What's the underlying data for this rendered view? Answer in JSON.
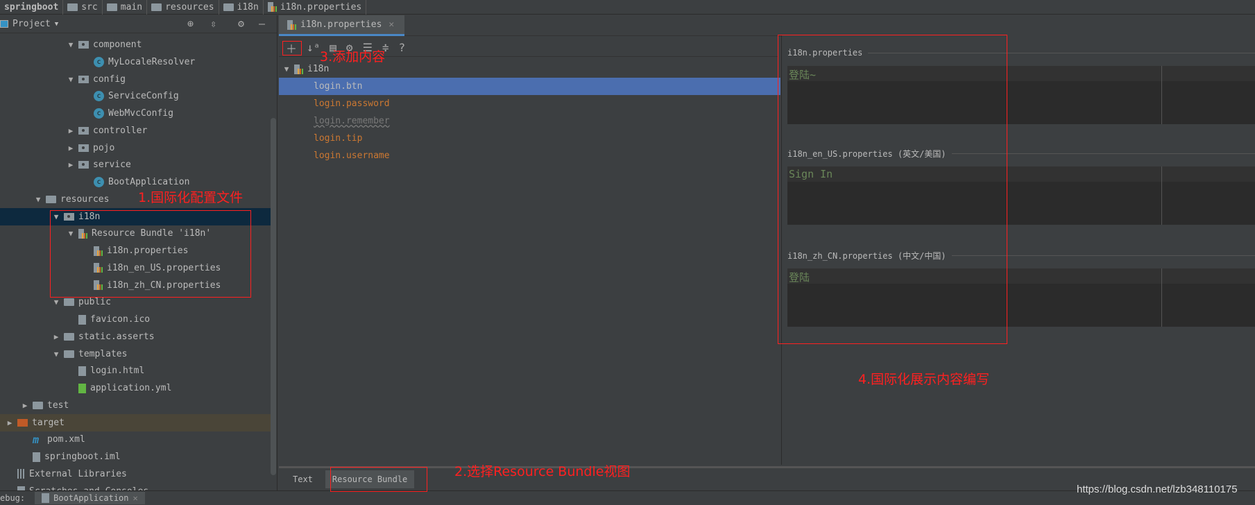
{
  "breadcrumb": [
    "springboot",
    "src",
    "main",
    "resources",
    "i18n",
    "i18n.properties"
  ],
  "project": {
    "title": "Project",
    "tree": [
      {
        "label": "component",
        "depth": 4,
        "icon": "package",
        "expanded": true
      },
      {
        "label": "MyLocaleResolver",
        "depth": 5,
        "icon": "class"
      },
      {
        "label": "config",
        "depth": 4,
        "icon": "package",
        "expanded": true
      },
      {
        "label": "ServiceConfig",
        "depth": 5,
        "icon": "class"
      },
      {
        "label": "WebMvcConfig",
        "depth": 5,
        "icon": "class"
      },
      {
        "label": "controller",
        "depth": 4,
        "icon": "package",
        "expanded": false
      },
      {
        "label": "pojo",
        "depth": 4,
        "icon": "package",
        "expanded": false
      },
      {
        "label": "service",
        "depth": 4,
        "icon": "package",
        "expanded": false
      },
      {
        "label": "BootApplication",
        "depth": 5,
        "icon": "spring-class"
      },
      {
        "label": "resources",
        "depth": 2,
        "icon": "resources-folder",
        "expanded": true
      },
      {
        "label": "i18n",
        "depth": 3,
        "icon": "package",
        "expanded": true,
        "selected": true
      },
      {
        "label": "Resource Bundle 'i18n'",
        "depth": 4,
        "icon": "resource-bundle",
        "expanded": true
      },
      {
        "label": "i18n.properties",
        "depth": 5,
        "icon": "properties"
      },
      {
        "label": "i18n_en_US.properties",
        "depth": 5,
        "icon": "properties"
      },
      {
        "label": "i18n_zh_CN.properties",
        "depth": 5,
        "icon": "properties"
      },
      {
        "label": "public",
        "depth": 3,
        "icon": "folder",
        "expanded": true
      },
      {
        "label": "favicon.ico",
        "depth": 4,
        "icon": "file"
      },
      {
        "label": "static.asserts",
        "depth": 3,
        "icon": "folder",
        "expanded": false
      },
      {
        "label": "templates",
        "depth": 3,
        "icon": "folder",
        "expanded": true
      },
      {
        "label": "login.html",
        "depth": 4,
        "icon": "html"
      },
      {
        "label": "application.yml",
        "depth": 4,
        "icon": "yml"
      },
      {
        "label": "test",
        "depth": 1,
        "icon": "folder",
        "expanded": false
      },
      {
        "label": "target",
        "depth": 0,
        "icon": "excluded-folder",
        "expanded": false,
        "highlight": true
      },
      {
        "label": "pom.xml",
        "depth": 1,
        "icon": "maven"
      },
      {
        "label": "springboot.iml",
        "depth": 1,
        "icon": "file"
      },
      {
        "label": "External Libraries",
        "depth": 0,
        "icon": "libraries"
      },
      {
        "label": "Scratches and Consoles",
        "depth": 0,
        "icon": "scratches"
      }
    ]
  },
  "editor": {
    "tab": "i18n.properties",
    "bundle": "i18n",
    "keys": [
      {
        "label": "login.btn",
        "selected": true
      },
      {
        "label": "login.password"
      },
      {
        "label": "login.remember",
        "warning": true
      },
      {
        "label": "login.tip"
      },
      {
        "label": "login.username"
      }
    ],
    "toolbar": [
      "plus-icon",
      "sort-alpha-icon",
      "group-icon",
      "gear-icon",
      "expand-all-icon",
      "collapse-all-icon",
      "help-icon"
    ]
  },
  "values": [
    {
      "file": "i18n.properties",
      "value": "登陆~"
    },
    {
      "file": "i18n_en_US.properties (英文/美国)",
      "value": "Sign In"
    },
    {
      "file": "i18n_zh_CN.properties (中文/中国)",
      "value": "登陆"
    }
  ],
  "bottom_tabs": [
    "Text",
    "Resource Bundle"
  ],
  "status": {
    "debug": "ebug:",
    "run": "BootApplication"
  },
  "annotations": {
    "a1": "1.国际化配置文件",
    "a2": "2.选择Resource Bundle视图",
    "a3": "3.添加内容",
    "a4": "4.国际化展示内容编写"
  },
  "watermark": "https://blog.csdn.net/lzb348110175",
  "colors": {
    "selection": "#4b6eaf",
    "key": "#cc7832",
    "value": "#6a8759",
    "annotation": "#ff2020"
  }
}
